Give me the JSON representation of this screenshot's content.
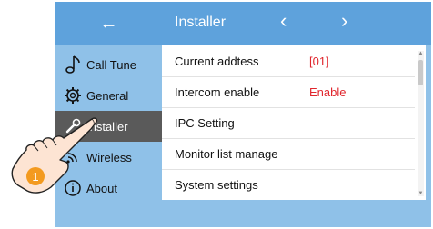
{
  "header": {
    "back_icon": "←",
    "title": "Installer",
    "prev_icon": "‹",
    "next_icon": "›"
  },
  "sidebar": {
    "items": [
      {
        "label": "Call Tune",
        "icon": "music-note-icon"
      },
      {
        "label": "General",
        "icon": "gear-icon"
      },
      {
        "label": "Installer",
        "icon": "wrench-icon",
        "active": true
      },
      {
        "label": "Wireless",
        "icon": "wireless-icon"
      },
      {
        "label": "About",
        "icon": "info-icon"
      }
    ]
  },
  "settings": {
    "rows": [
      {
        "label": "Current addtess",
        "value": "[01]"
      },
      {
        "label": "Intercom enable",
        "value": "Enable"
      },
      {
        "label": "IPC Setting",
        "value": ""
      },
      {
        "label": "Monitor list manage",
        "value": ""
      },
      {
        "label": "System settings",
        "value": ""
      }
    ]
  },
  "overlay": {
    "step_badge": "1",
    "hand_icon": "pointing-hand-icon"
  },
  "colors": {
    "header_bg": "#5ea2dc",
    "sidebar_bg": "#8fc1e8",
    "active_item_bg": "#5a5a5a",
    "value_text": "#e0262d",
    "badge": "#f39a1f"
  }
}
